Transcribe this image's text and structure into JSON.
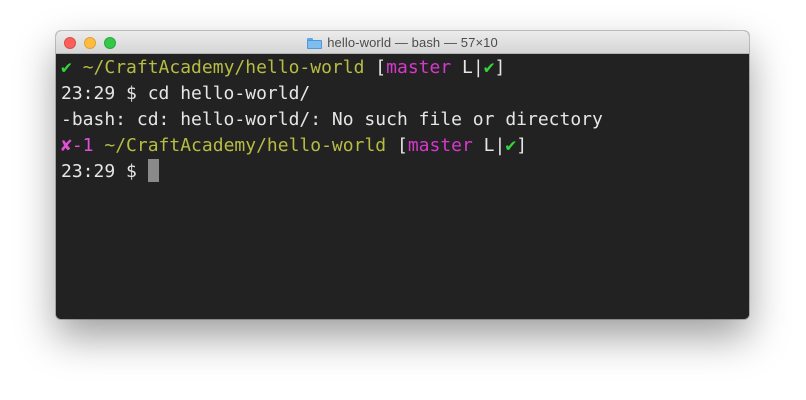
{
  "window": {
    "title": "hello-world — bash — 57×10"
  },
  "terminal": {
    "line1": {
      "status": "✔",
      "path": "~/CraftAcademy/hello-world",
      "open": "[",
      "branch": "master",
      "tail": " L|",
      "check": "✔",
      "close": "]"
    },
    "line2": {
      "prompt": "23:29 $ ",
      "command": "cd hello-world/"
    },
    "line3": {
      "output": "-bash: cd: hello-world/: No such file or directory"
    },
    "line4": {
      "status": "✘-1",
      "path": "~/CraftAcademy/hello-world",
      "open": "[",
      "branch": "master",
      "tail": " L|",
      "check": "✔",
      "close": "]"
    },
    "line5": {
      "prompt": "23:29 $ "
    }
  },
  "colors": {
    "background": "#222222",
    "text": "#e6e6e6",
    "success": "#38d23c",
    "path": "#b7bd42",
    "branch": "#d638cc",
    "error": "#e050d8"
  }
}
